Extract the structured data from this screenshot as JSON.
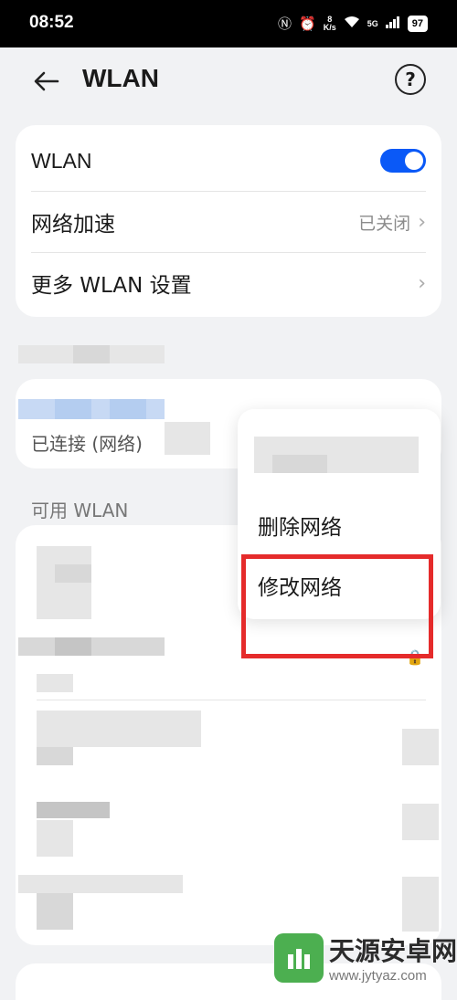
{
  "status_bar": {
    "time": "08:52",
    "speed_value": "8",
    "speed_unit": "K/s",
    "network": "5G",
    "battery": "97"
  },
  "header": {
    "title": "WLAN",
    "help_label": "?"
  },
  "settings": {
    "wlan_label": "WLAN",
    "wlan_enabled": true,
    "accel_label": "网络加速",
    "accel_value": "已关闭",
    "more_label": "更多 WLAN 设置"
  },
  "connected": {
    "status": "已连接 (网络)"
  },
  "available": {
    "heading": "可用 WLAN"
  },
  "context_menu": {
    "delete_label": "删除网络",
    "modify_label": "修改网络"
  },
  "watermark": {
    "title": "天源安卓网",
    "url": "www.jytyaz.com"
  },
  "colors": {
    "accent": "#0a59f7",
    "highlight": "#e52b2b"
  }
}
